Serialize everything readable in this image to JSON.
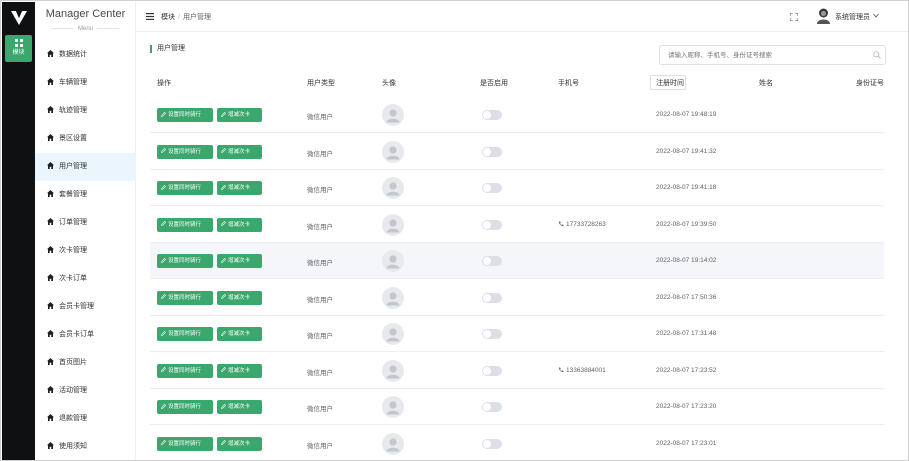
{
  "sidebar": {
    "app_title": "Manager Center",
    "menu_subtitle": "Menu",
    "rail_label": "模块",
    "items": [
      {
        "label": "数据统计",
        "active": false
      },
      {
        "label": "车辆管理",
        "active": false
      },
      {
        "label": "轨迹管理",
        "active": false
      },
      {
        "label": "景区设置",
        "active": false
      },
      {
        "label": "用户管理",
        "active": true
      },
      {
        "label": "套餐管理",
        "active": false
      },
      {
        "label": "订单管理",
        "active": false
      },
      {
        "label": "次卡管理",
        "active": false
      },
      {
        "label": "次卡订单",
        "active": false
      },
      {
        "label": "会员卡管理",
        "active": false
      },
      {
        "label": "会员卡订单",
        "active": false
      },
      {
        "label": "首页图片",
        "active": false
      },
      {
        "label": "活动管理",
        "active": false
      },
      {
        "label": "退款管理",
        "active": false
      },
      {
        "label": "使用须知",
        "active": false
      }
    ]
  },
  "header": {
    "breadcrumb_root": "模块",
    "breadcrumb_current": "用户管理",
    "user_name": "系统管理员"
  },
  "main": {
    "section_title": "用户管理",
    "search_placeholder": "请输入昵称、手机号、身份证号搜索",
    "columns": [
      "操作",
      "用户类型",
      "头像",
      "是否启用",
      "手机号",
      "注册时间",
      "姓名",
      "身份证号"
    ],
    "button_1_label": "设置同时骑行",
    "button_2_label": "增减次卡",
    "rows": [
      {
        "user_type": "微信用户",
        "phone": "",
        "time": "2022-08-07 19:48:19",
        "highlight": false
      },
      {
        "user_type": "微信用户",
        "phone": "",
        "time": "2022-08-07 19:41:32",
        "highlight": false
      },
      {
        "user_type": "微信用户",
        "phone": "",
        "time": "2022-08-07 19:41:18",
        "highlight": false
      },
      {
        "user_type": "微信用户",
        "phone": "17733728263",
        "time": "2022-08-07 19:39:50",
        "highlight": false
      },
      {
        "user_type": "微信用户",
        "phone": "",
        "time": "2022-08-07 19:14:02",
        "highlight": true
      },
      {
        "user_type": "微信用户",
        "phone": "",
        "time": "2022-08-07 17:50:36",
        "highlight": false
      },
      {
        "user_type": "微信用户",
        "phone": "",
        "time": "2022-08-07 17:31:48",
        "highlight": false
      },
      {
        "user_type": "微信用户",
        "phone": "13363884001",
        "time": "2022-08-07 17:23:52",
        "highlight": false
      },
      {
        "user_type": "微信用户",
        "phone": "",
        "time": "2022-08-07 17:23:20",
        "highlight": false
      },
      {
        "user_type": "微信用户",
        "phone": "",
        "time": "2022-08-07 17:23:01",
        "highlight": false
      }
    ]
  },
  "colors": {
    "accent": "#3aa76d",
    "rail_bg": "#0f1012",
    "active_menu_bg": "#eaf5fe"
  }
}
